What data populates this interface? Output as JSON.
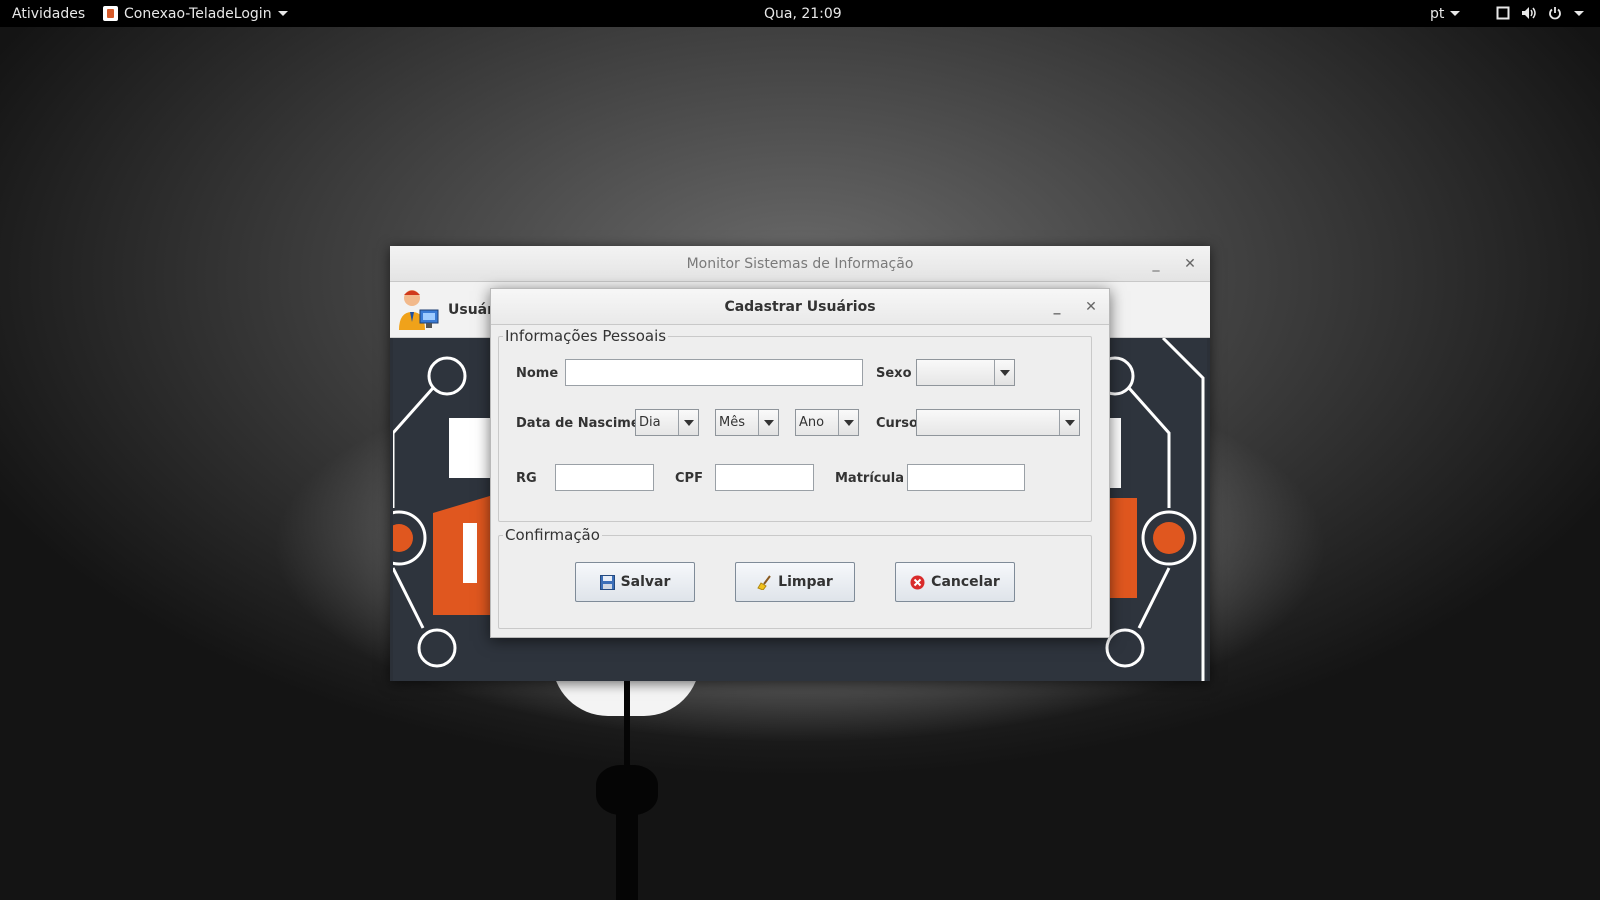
{
  "topbar": {
    "activities": "Atividades",
    "app_name": "Conexao-TeladeLogin",
    "clock": "Qua, 21:09",
    "language": "pt"
  },
  "main_window": {
    "title": "Monitor Sistemas de Informação",
    "toolbar_user_label": "Usuár"
  },
  "dialog": {
    "title": "Cadastrar Usuários",
    "personal_group": "Informações Pessoais",
    "nome_label": "Nome",
    "nome_value": "",
    "sexo_label": "Sexo",
    "sexo_value": "",
    "data_label": "Data de Nascimento",
    "dia_value": "Dia",
    "mes_value": "Mês",
    "ano_value": "Ano",
    "curso_label": "Curso",
    "curso_value": "",
    "rg_label": "RG",
    "rg_value": "",
    "cpf_label": "CPF",
    "cpf_value": "",
    "matricula_label": "Matrícula",
    "matricula_value": "",
    "confirm_group": "Confirmação",
    "salvar": "Salvar",
    "limpar": "Limpar",
    "cancelar": "Cancelar"
  },
  "colors": {
    "accent_orange": "#e0571f",
    "canvas_dark": "#2e343d",
    "cancel_red": "#d92b2b"
  }
}
